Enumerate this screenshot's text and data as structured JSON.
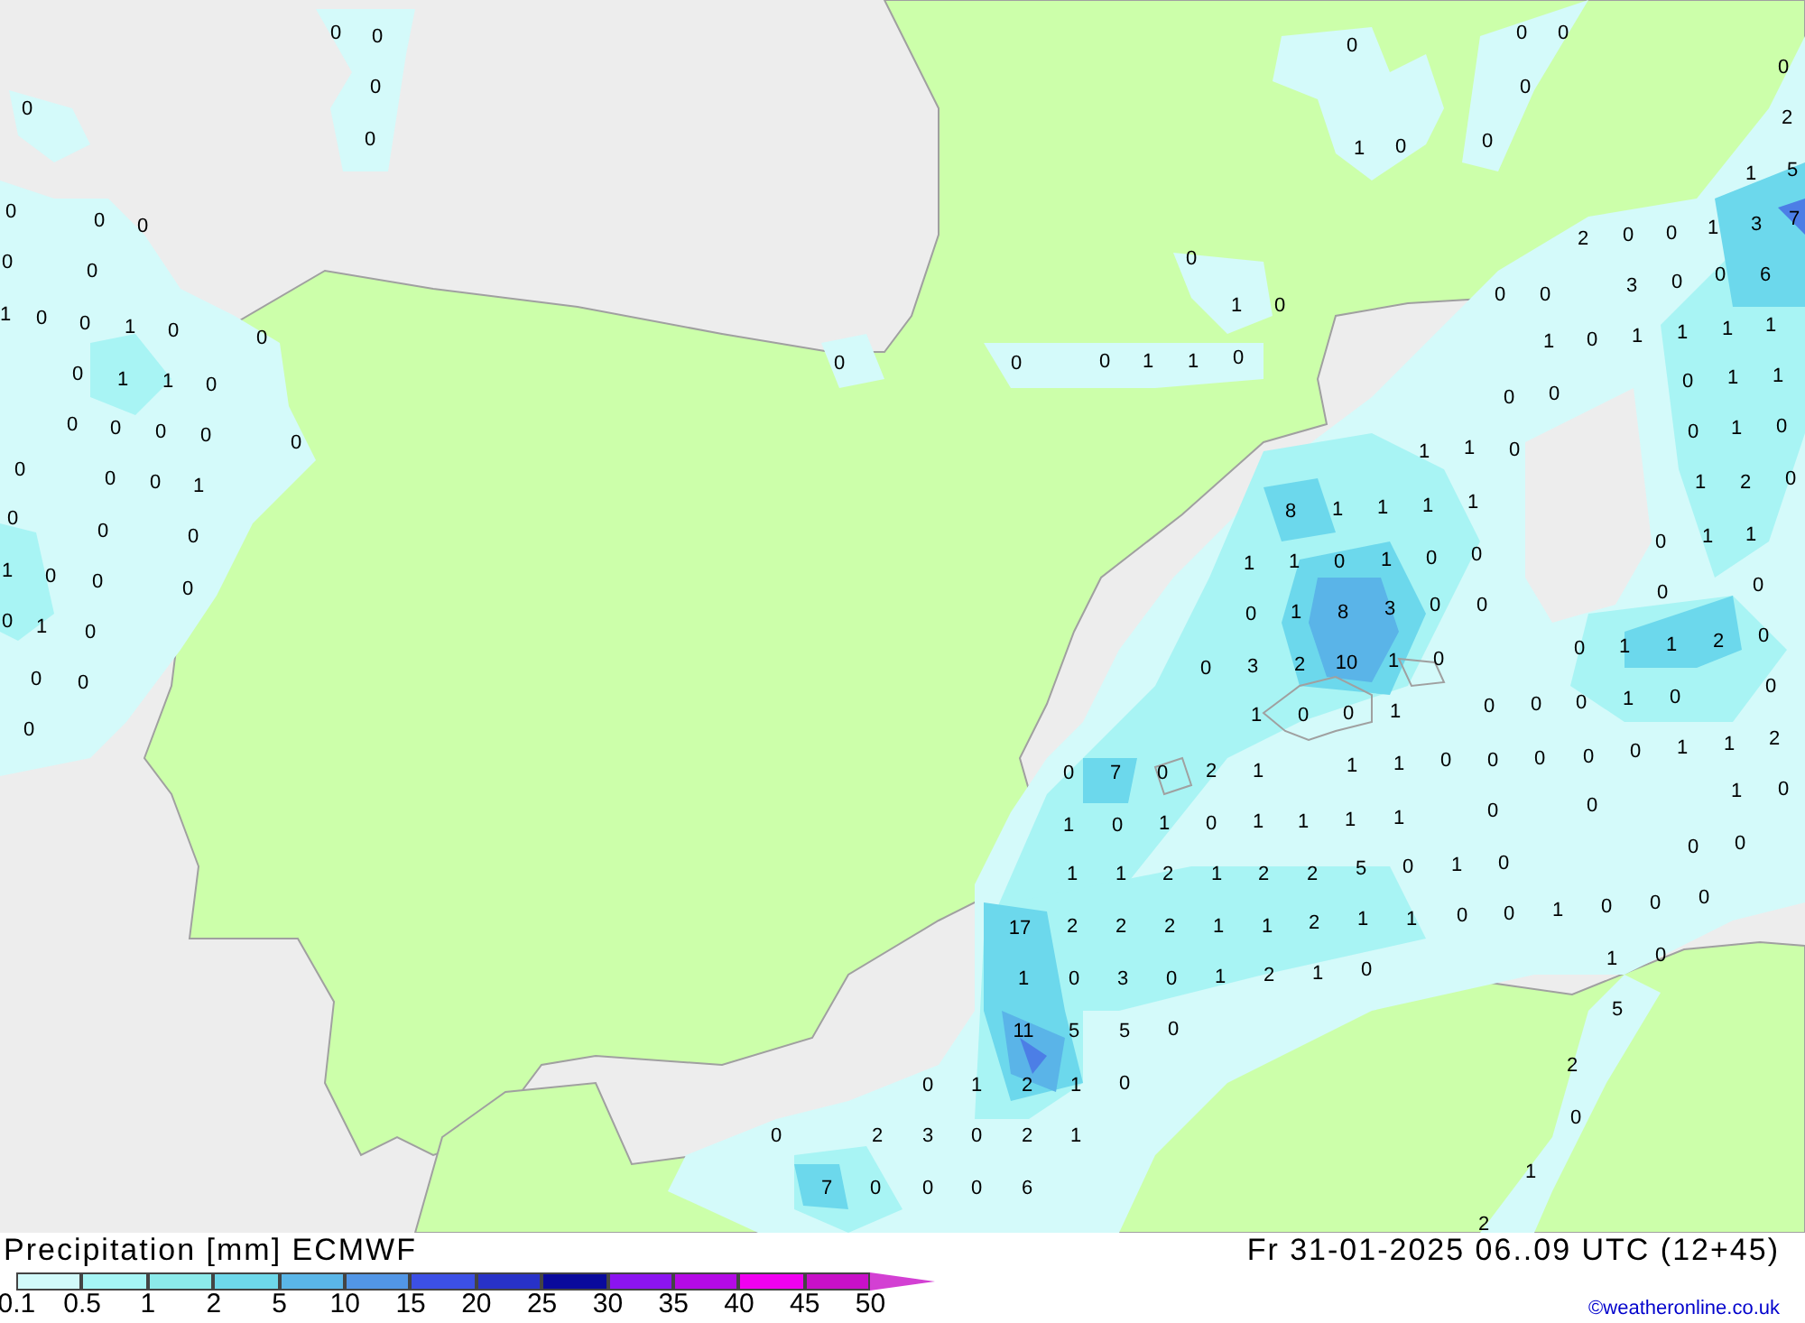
{
  "map": {
    "values": [
      "0",
      "0",
      "0",
      "0",
      "0",
      "0",
      "0",
      "0",
      "0",
      "0",
      "2",
      "1",
      "0",
      "0",
      "1",
      "5",
      "0",
      "0",
      "0",
      "3",
      "7",
      "2",
      "0",
      "0",
      "1",
      "0",
      "0",
      "0",
      "0",
      "0",
      "3",
      "0",
      "0",
      "6",
      "1",
      "0",
      "1",
      "0",
      "0",
      "1",
      "0",
      "0",
      "1",
      "0",
      "1",
      "1",
      "1",
      "1",
      "0",
      "0",
      "0",
      "1",
      "1",
      "0",
      "0",
      "1",
      "1",
      "0",
      "0",
      "0",
      "0",
      "1",
      "1",
      "0",
      "0",
      "0",
      "0",
      "0",
      "0",
      "1",
      "0",
      "1",
      "1",
      "0",
      "0",
      "0",
      "0",
      "1",
      "1",
      "2",
      "0",
      "8",
      "1",
      "1",
      "1",
      "1",
      "0",
      "0",
      "0",
      "0",
      "1",
      "1",
      "1",
      "1",
      "0",
      "1",
      "0",
      "0",
      "1",
      "0",
      "0",
      "0",
      "0",
      "0",
      "0",
      "1",
      "8",
      "3",
      "0",
      "0",
      "0",
      "1",
      "0",
      "0",
      "1",
      "1",
      "2",
      "0",
      "0",
      "3",
      "2",
      "10",
      "1",
      "0",
      "0",
      "0",
      "0",
      "0",
      "0",
      "1",
      "0",
      "0",
      "1",
      "0",
      "0",
      "1",
      "0",
      "0",
      "7",
      "0",
      "2",
      "1",
      "1",
      "1",
      "0",
      "0",
      "0",
      "0",
      "0",
      "1",
      "1",
      "2",
      "0",
      "1",
      "0",
      "1",
      "0",
      "1",
      "0",
      "1",
      "1",
      "1",
      "1",
      "0",
      "0",
      "0",
      "1",
      "1",
      "2",
      "1",
      "2",
      "2",
      "5",
      "0",
      "1",
      "0",
      "17",
      "2",
      "2",
      "2",
      "1",
      "1",
      "2",
      "1",
      "1",
      "0",
      "0",
      "1",
      "0",
      "0",
      "0",
      "1",
      "0",
      "1",
      "0",
      "3",
      "0",
      "1",
      "2",
      "1",
      "0",
      "11",
      "5",
      "5",
      "0",
      "5",
      "0",
      "1",
      "2",
      "1",
      "0",
      "2",
      "0",
      "0",
      "2",
      "3",
      "0",
      "2",
      "1",
      "7",
      "0",
      "0",
      "0",
      "6",
      "1",
      "2"
    ]
  },
  "legend": {
    "title": "Precipitation [mm] ECMWF",
    "run": "Fr 31-01-2025 06..09 UTC (12+45)",
    "bins": [
      {
        "color": "#d2fafa"
      },
      {
        "color": "#a6f5f5"
      },
      {
        "color": "#8ceaea"
      },
      {
        "color": "#6ed8ea"
      },
      {
        "color": "#5ab6e8"
      },
      {
        "color": "#5296e6"
      },
      {
        "color": "#3c50e6"
      },
      {
        "color": "#2832c8"
      },
      {
        "color": "#0a0a9c"
      },
      {
        "color": "#8c14f0"
      },
      {
        "color": "#b40ae6"
      },
      {
        "color": "#f000f0"
      },
      {
        "color": "#c810c8"
      }
    ],
    "labels": [
      "0.1",
      "0.5",
      "1",
      "2",
      "5",
      "10",
      "15",
      "20",
      "25",
      "30",
      "35",
      "40",
      "45",
      "50"
    ],
    "credit": "©weatheronline.co.uk"
  }
}
